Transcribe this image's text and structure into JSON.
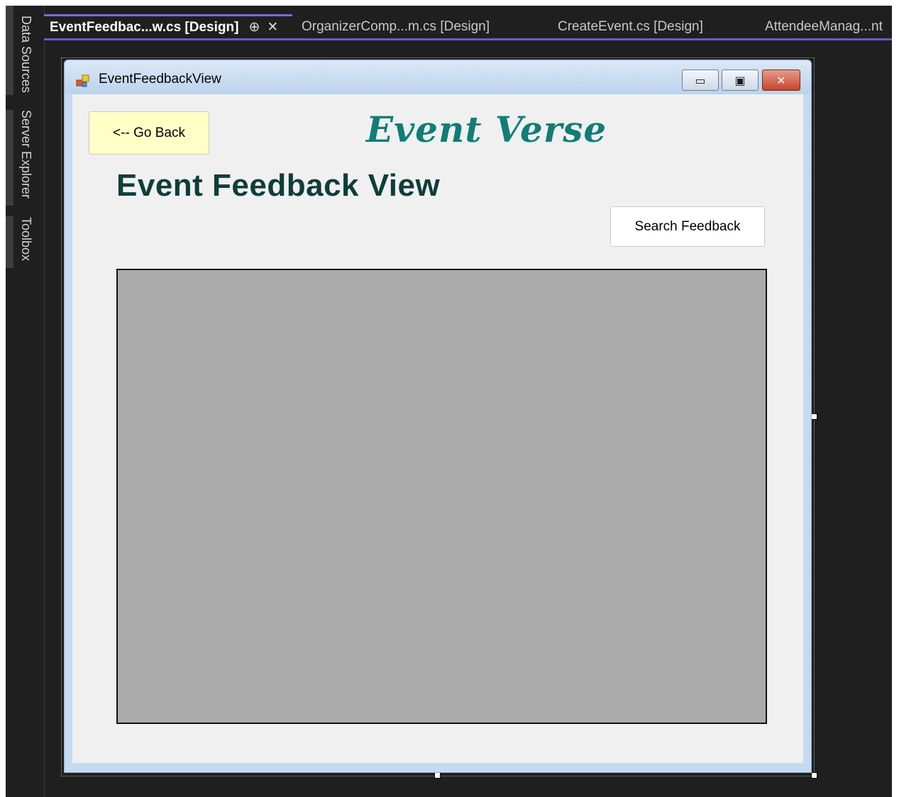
{
  "side_panels": [
    {
      "label": "Data Sources"
    },
    {
      "label": "Server Explorer"
    },
    {
      "label": "Toolbox"
    }
  ],
  "tabs": [
    {
      "label": "EventFeedbac...w.cs [Design]",
      "pin": "⊕",
      "close": "✕"
    },
    {
      "label": "OrganizerComp...m.cs [Design]"
    },
    {
      "label": "CreateEvent.cs [Design]"
    },
    {
      "label": "AttendeeManag...nt"
    }
  ],
  "form": {
    "title": "EventFeedbackView",
    "controls": {
      "minimize": "▭",
      "maximize": "▣",
      "close": "✕"
    },
    "go_back_label": "<-- Go Back",
    "brand": "Event Verse",
    "page_title": "Event Feedback View",
    "search_label": "Search Feedback"
  },
  "colors": {
    "accent_tab": "#6a5acd",
    "go_back_bg": "#ffffc6",
    "brand_text": "#117d77",
    "heading_text": "#0f3d3a",
    "grid_bg": "#ababab"
  }
}
